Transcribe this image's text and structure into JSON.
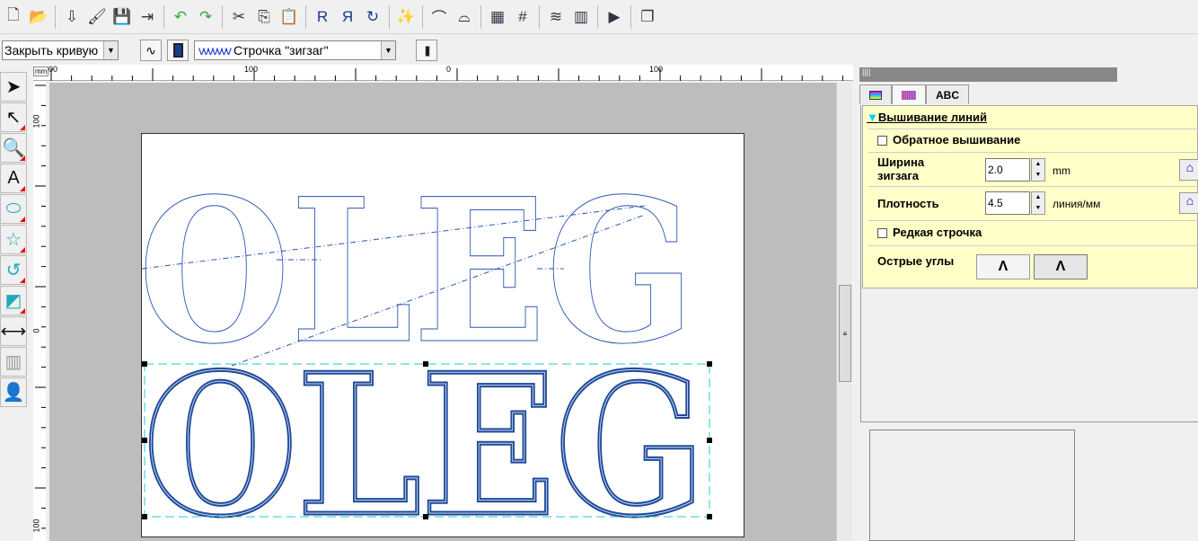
{
  "toolbar": {
    "icons": [
      "new-icon",
      "open-icon",
      "import-icon",
      "import-image-icon",
      "save-icon",
      "export-icon",
      "undo-icon",
      "redo-icon",
      "cut-icon",
      "copy-icon",
      "paste-icon",
      "mirror-horizontal-icon",
      "mirror-vertical-icon",
      "rotate-icon",
      "wizard-icon",
      "text-arc-down-icon",
      "text-arc-up-icon",
      "stitch-view-icon",
      "numbering-icon",
      "realistic-view-icon",
      "color-view-icon",
      "stitch-simulator-icon",
      "window-icon"
    ]
  },
  "props": {
    "close_curve": "Закрыть кривую",
    "stitch_type": "Строчка \"зигзаг\""
  },
  "ruler": {
    "unit": "mm",
    "h_labels": [
      "00",
      "100",
      "0",
      "100"
    ],
    "v_labels": [
      "100",
      "0",
      "100"
    ]
  },
  "tools": [
    "select-arrow-icon",
    "edit-points-icon",
    "zoom-icon",
    "text-icon",
    "shapes-icon",
    "heart-star-icon",
    "freeform-icon",
    "applique-icon",
    "measure-icon",
    "stitch-icon",
    "portrait-icon"
  ],
  "design": {
    "text": "OLEG",
    "color": "#1d4a9a"
  },
  "panel": {
    "tabs": [
      "",
      "",
      "ABC"
    ],
    "section_title": "Вышивание линий",
    "reverse_label": "Обратное вышивание",
    "reverse_checked": false,
    "width_label_1": "Ширина",
    "width_label_2": "зигзага",
    "width_value": "2.0",
    "width_unit": "mm",
    "density_label": "Плотность",
    "density_value": "4.5",
    "density_unit": "линия/мм",
    "sparse_label": "Редкая строчка",
    "sparse_checked": false,
    "corners_label": "Острые углы"
  }
}
